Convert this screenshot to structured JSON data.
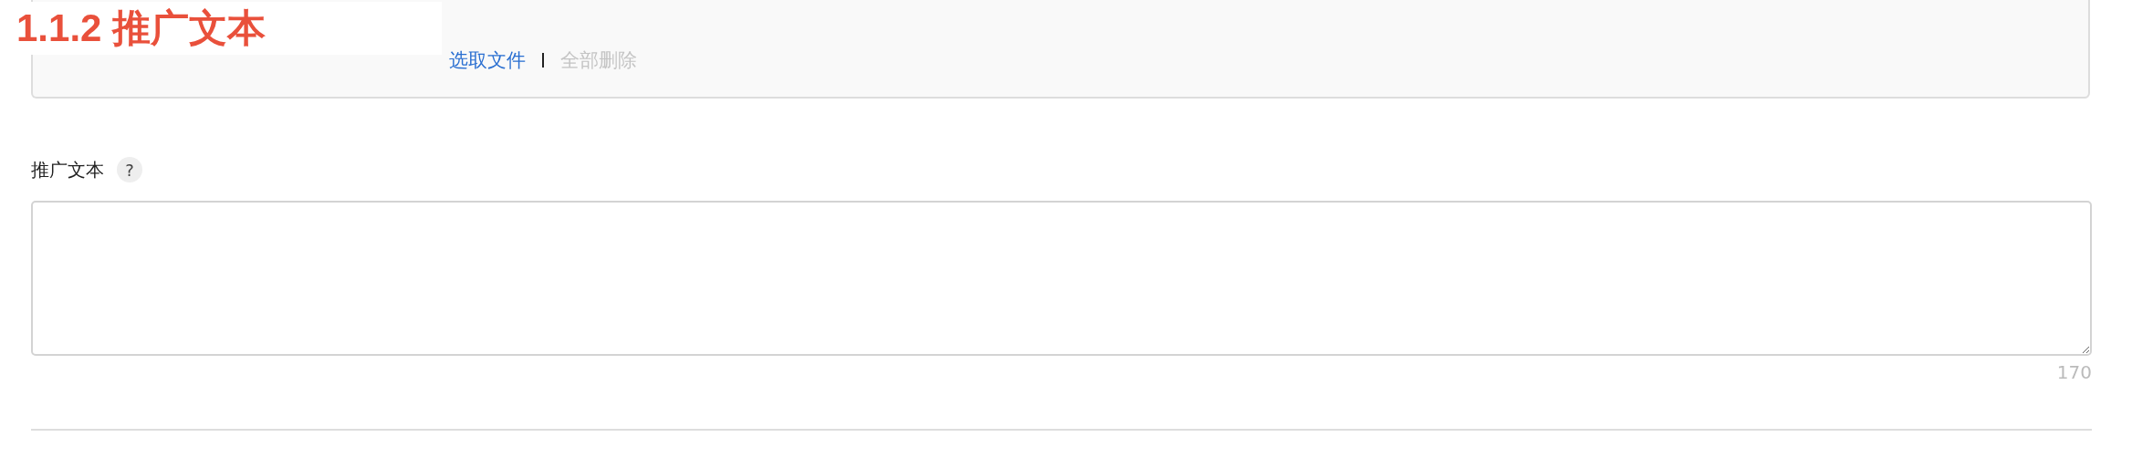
{
  "overlay_heading": "1.1.2 推广文本",
  "upload_panel": {
    "links": [
      {
        "label": "选取文件",
        "disabled": false
      },
      {
        "label": "全部删除",
        "disabled": true
      }
    ]
  },
  "field": {
    "label": "推广文本",
    "help": "?",
    "counter": "170"
  }
}
